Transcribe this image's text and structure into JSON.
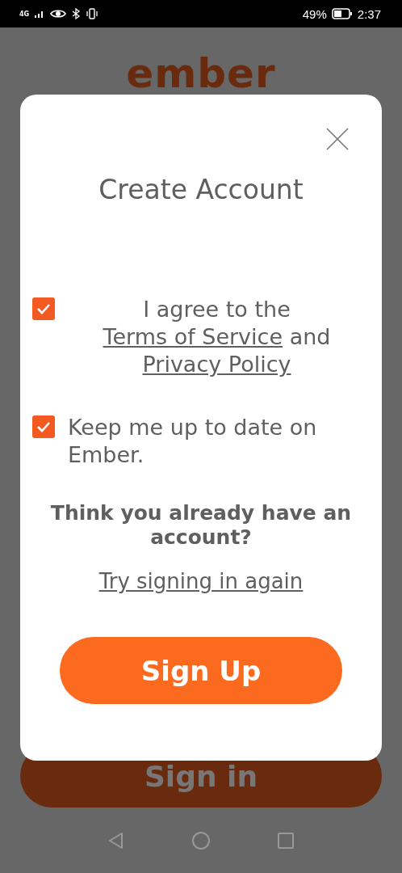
{
  "status_bar": {
    "network": "4G",
    "battery": "49%",
    "time": "2:37"
  },
  "logo": "ember",
  "background_button": "Sign in",
  "dialog": {
    "title": "Create Account",
    "options": [
      {
        "checked": true,
        "segments": [
          {
            "kind": "text",
            "text": "I agree to the"
          },
          {
            "kind": "link",
            "text": "Terms of Service"
          },
          {
            "kind": "text",
            "text": "and"
          },
          {
            "kind": "link",
            "text": "Privacy Policy"
          }
        ]
      },
      {
        "checked": true,
        "segments": [
          {
            "kind": "text",
            "text": "Keep me up to date on Ember."
          }
        ]
      }
    ],
    "prompt": "Think you already have an account?",
    "link": "Try signing in again",
    "button": "Sign Up"
  }
}
